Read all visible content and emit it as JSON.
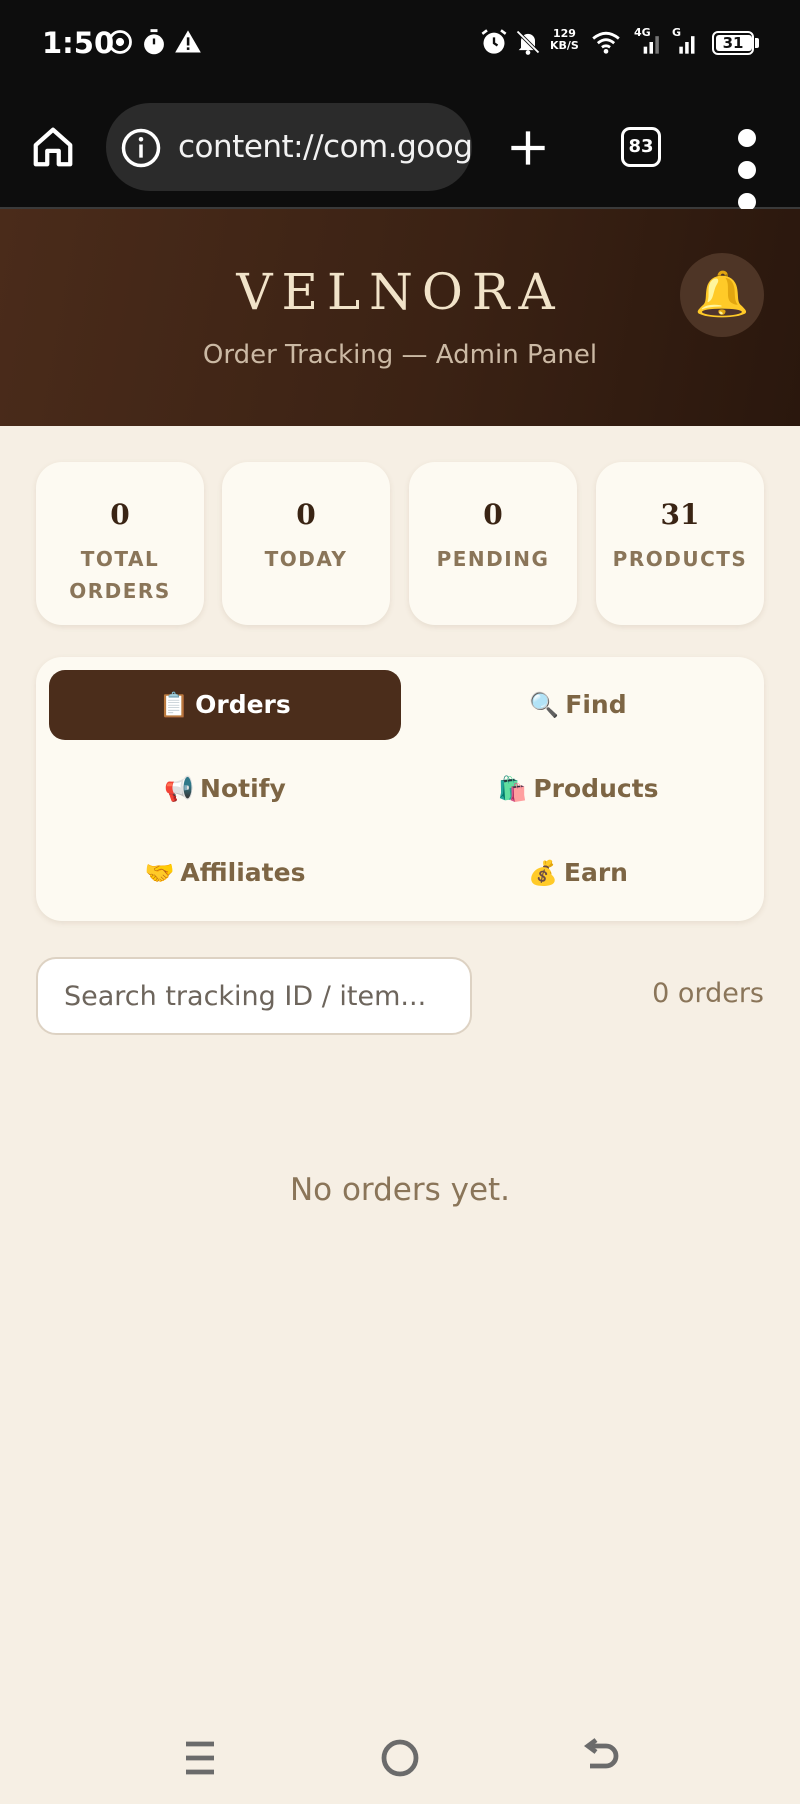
{
  "status_bar": {
    "time": "1:50",
    "net_speed_value": "129",
    "net_speed_unit": "KB/S",
    "signal_1_label": "4G",
    "signal_2_label": "G",
    "battery_level": "31"
  },
  "browser": {
    "url": "content://com.googl",
    "tab_count": "83"
  },
  "header": {
    "brand": "VELNORA",
    "subtitle": "Order Tracking — Admin Panel",
    "bell": "🔔"
  },
  "stats": [
    {
      "value": "0",
      "label": "TOTAL ORDERS"
    },
    {
      "value": "0",
      "label": "TODAY"
    },
    {
      "value": "0",
      "label": "PENDING"
    },
    {
      "value": "31",
      "label": "PRODUCTS"
    }
  ],
  "tabs": [
    {
      "emoji": "📋",
      "label": "Orders",
      "active": true
    },
    {
      "emoji": "🔍",
      "label": "Find"
    },
    {
      "emoji": "📢",
      "label": "Notify"
    },
    {
      "emoji": "🛍️",
      "label": "Products"
    },
    {
      "emoji": "🤝",
      "label": "Affiliates"
    },
    {
      "emoji": "💰",
      "label": "Earn"
    }
  ],
  "search": {
    "placeholder": "Search tracking ID / item..."
  },
  "orders": {
    "count_label": "0 orders",
    "empty_message": "No orders yet."
  },
  "colors": {
    "header_bg": "#3b2214",
    "active_tab": "#4b2d1b",
    "page_bg": "#f6efe4",
    "card_bg": "#fdfaf2",
    "muted_text": "#8a7559"
  }
}
